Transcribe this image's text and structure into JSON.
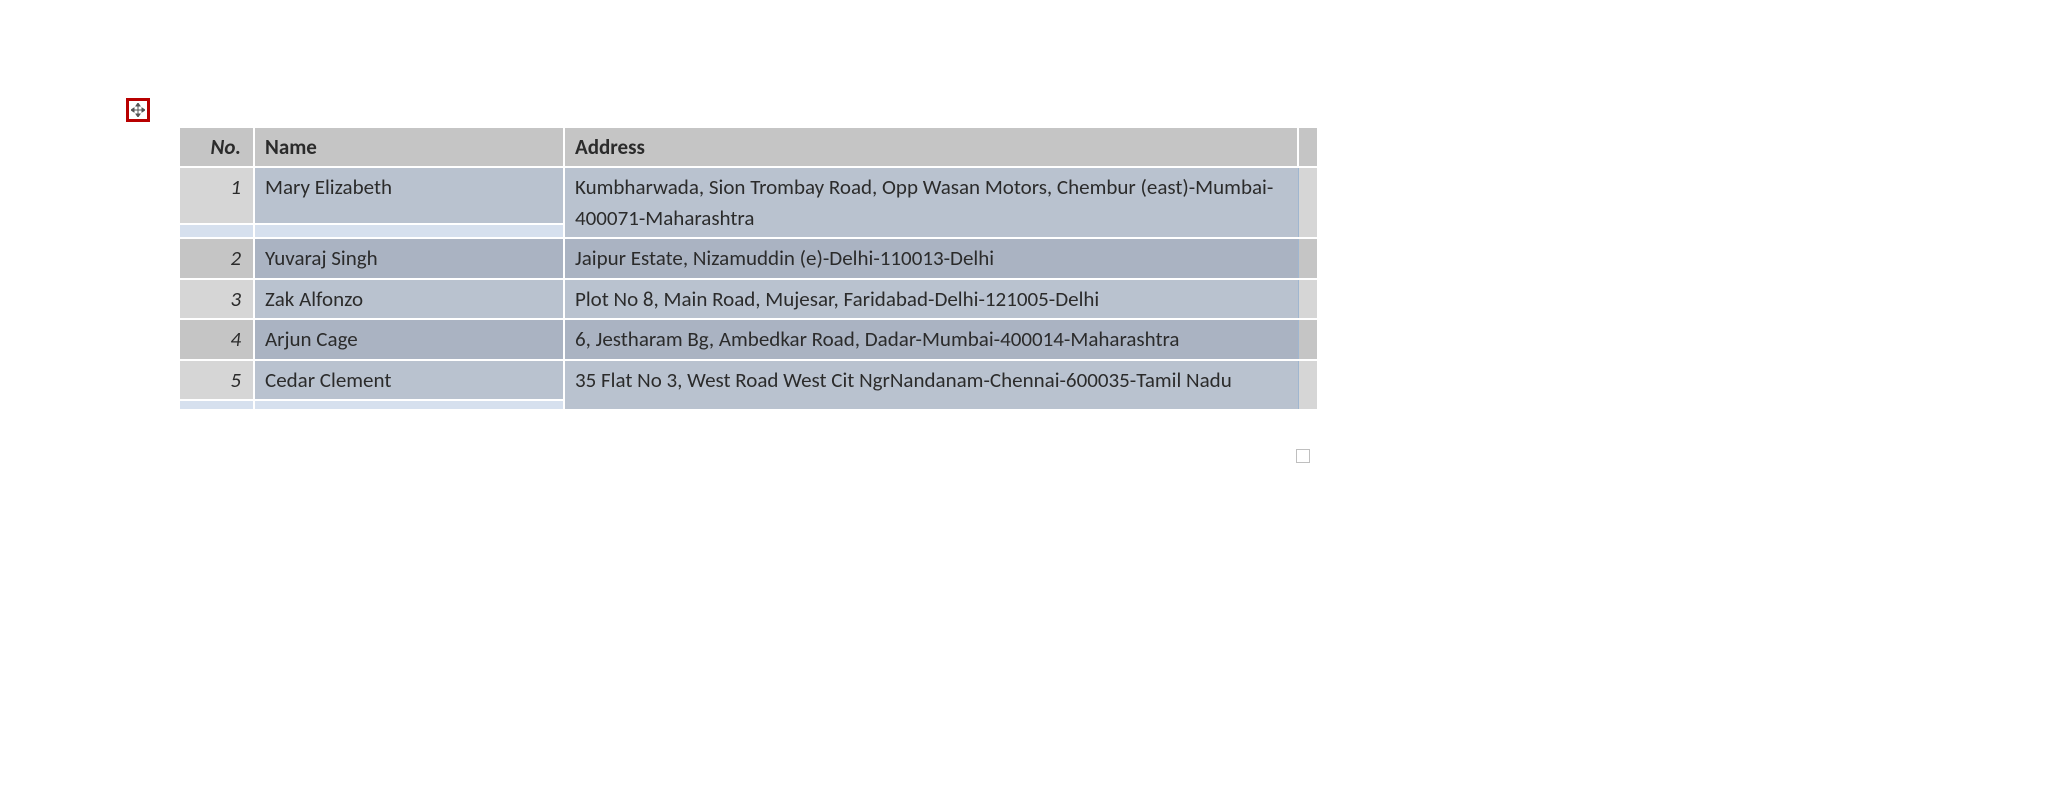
{
  "table": {
    "headers": {
      "no": "No.",
      "name": "Name",
      "address": "Address"
    },
    "rows": [
      {
        "no": "1",
        "name": "Mary Elizabeth",
        "address": "Kumbharwada, Sion Trombay Road, Opp Wasan Motors, Chembur (east)-Mumbai-400071-Maharashtra"
      },
      {
        "no": "2",
        "name": "Yuvaraj Singh",
        "address": "Jaipur Estate, Nizamuddin (e)-Delhi-110013-Delhi"
      },
      {
        "no": "3",
        "name": "Zak Alfonzo",
        "address": "Plot No 8, Main Road, Mujesar, Faridabad-Delhi-121005-Delhi"
      },
      {
        "no": "4",
        "name": "Arjun Cage",
        "address": "6, Jestharam Bg, Ambedkar Road, Dadar-Mumbai-400014-Maharashtra"
      },
      {
        "no": "5",
        "name": "Cedar Clement",
        "address": "35 Flat No 3, West Road West Cit NgrNandanam-Chennai-600035-Tamil Nadu"
      }
    ]
  }
}
